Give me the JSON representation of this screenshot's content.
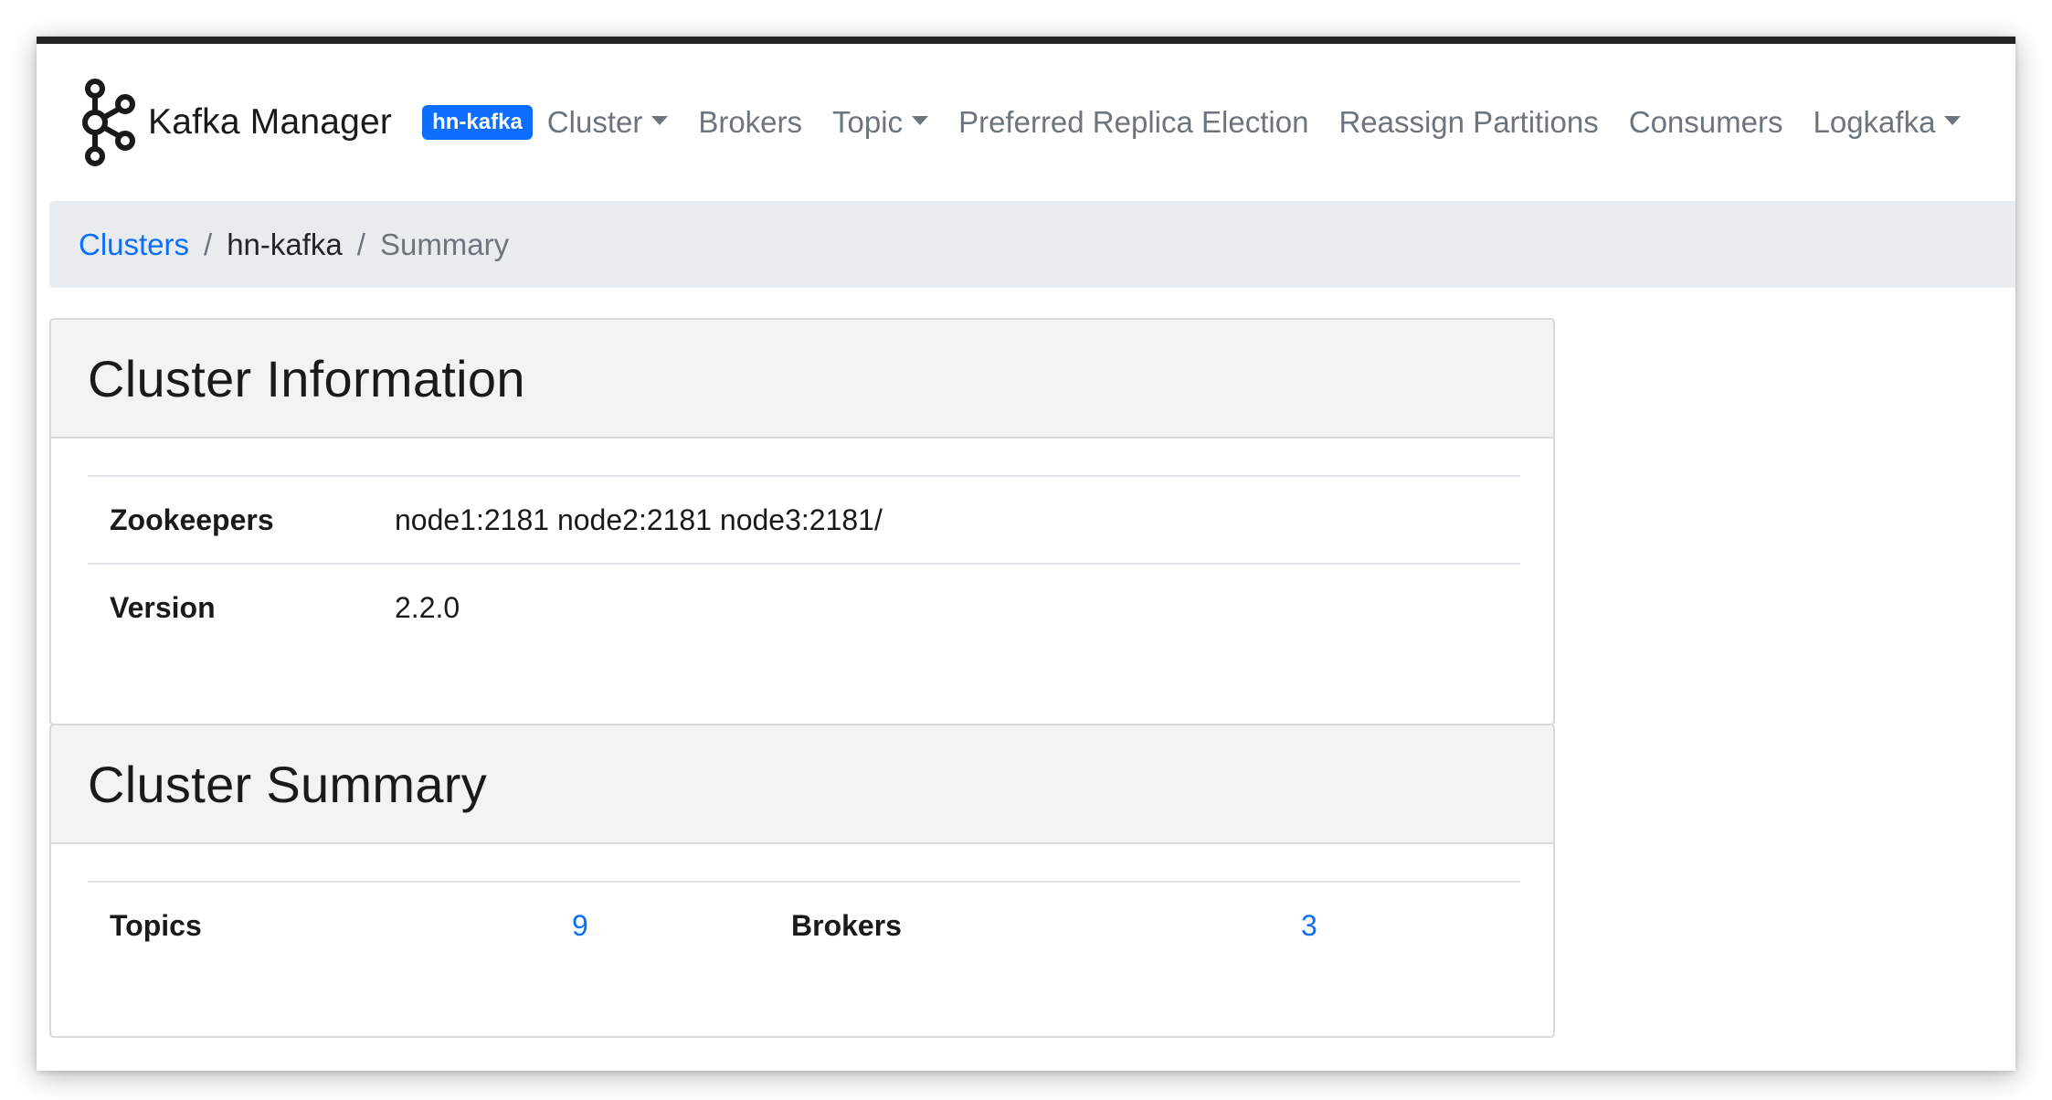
{
  "navbar": {
    "brand": "Kafka Manager",
    "cluster_badge": "hn-kafka",
    "items": [
      {
        "label": "Cluster",
        "dropdown": true
      },
      {
        "label": "Brokers",
        "dropdown": false
      },
      {
        "label": "Topic",
        "dropdown": true
      },
      {
        "label": "Preferred Replica Election",
        "dropdown": false
      },
      {
        "label": "Reassign Partitions",
        "dropdown": false
      },
      {
        "label": "Consumers",
        "dropdown": false
      },
      {
        "label": "Logkafka",
        "dropdown": true
      }
    ]
  },
  "breadcrumb": {
    "root": "Clusters",
    "separator": "/",
    "cluster": "hn-kafka",
    "current": "Summary"
  },
  "cluster_information": {
    "title": "Cluster Information",
    "rows": [
      {
        "label": "Zookeepers",
        "value": "node1:2181 node2:2181 node3:2181/"
      },
      {
        "label": "Version",
        "value": "2.2.0"
      }
    ]
  },
  "cluster_summary": {
    "title": "Cluster Summary",
    "topics_label": "Topics",
    "topics_value": "9",
    "brokers_label": "Brokers",
    "brokers_value": "3"
  },
  "colors": {
    "accent": "#0d6efd",
    "nav_text": "#6c757d",
    "breadcrumb_bg": "#e9ecef",
    "card_header_bg": "#f3f3f3",
    "window_top_border": "#222222"
  },
  "icons": {
    "brand_logo": "kafka-logo-icon",
    "dropdown": "caret-down-icon"
  }
}
